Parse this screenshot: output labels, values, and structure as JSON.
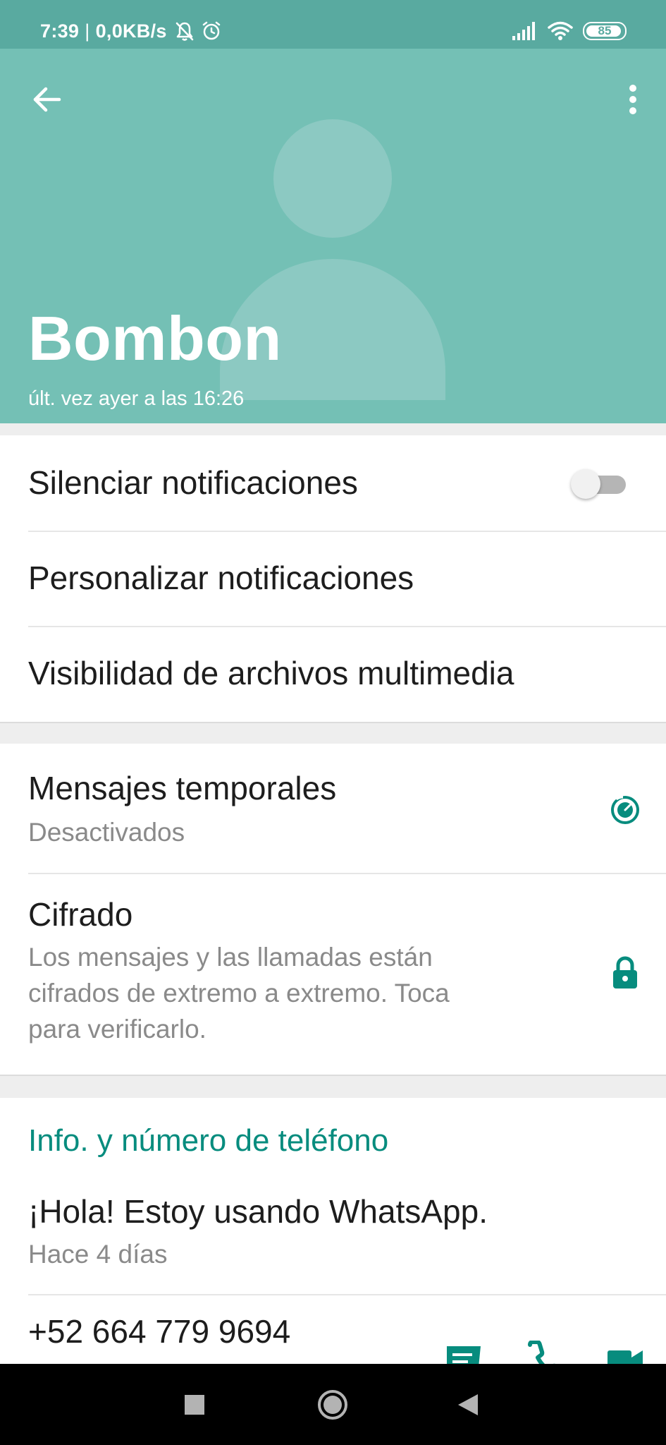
{
  "status_bar": {
    "time": "7:39",
    "separator": "|",
    "network_speed": "0,0KB/s",
    "battery_level": "85",
    "icons": [
      "notifications-off-icon",
      "alarm-icon",
      "signal-icon",
      "wifi-icon",
      "battery-icon"
    ]
  },
  "header": {
    "contact_name": "Bombon",
    "last_seen": "últ. vez ayer a las 16:26",
    "background_color": "#74c0b5",
    "icons": [
      "back-arrow-icon",
      "more-options-icon",
      "default-avatar-icon"
    ]
  },
  "notifications": {
    "mute_label": "Silenciar notificaciones",
    "mute_enabled": false,
    "custom_label": "Personalizar notificaciones",
    "media_visibility_label": "Visibilidad de archivos multimedia"
  },
  "privacy": {
    "disappearing_title": "Mensajes temporales",
    "disappearing_status": "Desactivados",
    "encryption_title": "Cifrado",
    "encryption_desc_line1": "Los mensajes y las llamadas están",
    "encryption_desc_line2": "cifrados de extremo a extremo. Toca",
    "encryption_desc_line3": "para verificarlo.",
    "accent_color": "#078c7e",
    "icons": [
      "timer-icon",
      "lock-icon"
    ]
  },
  "info": {
    "section_title": "Info. y número de teléfono",
    "about_text": "¡Hola! Estoy usando WhatsApp.",
    "about_date": "Hace 4 días",
    "phone_number": "+52 664 779 9694",
    "icons": [
      "message-icon",
      "phone-icon",
      "video-call-icon"
    ]
  },
  "nav_bar": {
    "icons": [
      "recents-square-icon",
      "home-circle-icon",
      "back-triangle-icon"
    ]
  }
}
